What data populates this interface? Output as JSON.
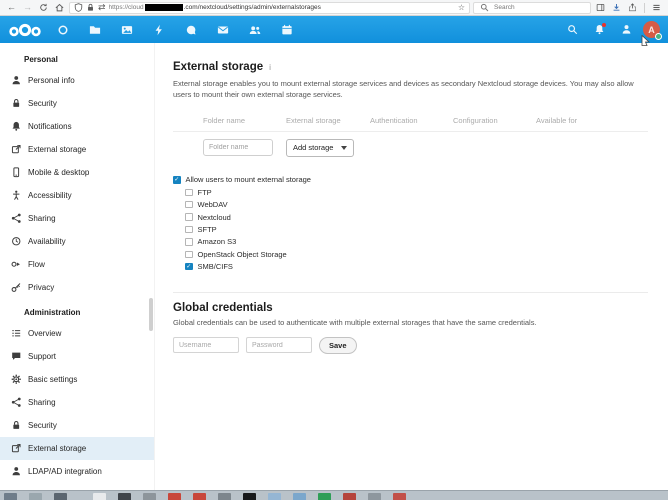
{
  "browser": {
    "icons": [
      "back-icon",
      "forward-icon",
      "reload-icon",
      "home-icon",
      "shield-icon",
      "lock-icon",
      "permissions-icon",
      "bookmark-star-icon",
      "search-icon",
      "sidebar-icon",
      "download-icon",
      "share-icon",
      "menu-icon"
    ],
    "url_prefix": "https://cloud",
    "url_redacted": true,
    "url_suffix": ".com/nextcloud/settings/admin/externalstorages",
    "search_placeholder": "Search"
  },
  "app_header": {
    "logo": "nextcloud-logo",
    "app_icons": [
      "dashboard-icon",
      "files-icon",
      "photos-icon",
      "activity-icon",
      "talk-icon",
      "mail-icon",
      "contacts-icon",
      "calendar-icon"
    ],
    "right_icons": [
      "search-icon",
      "notifications-icon",
      "contacts-menu-icon"
    ],
    "avatar_letter": "A",
    "has_unread_notification": true
  },
  "sidebar": {
    "sections": [
      {
        "title": "Personal",
        "items": [
          {
            "icon": "user-icon",
            "label": "Personal info"
          },
          {
            "icon": "lock-icon",
            "label": "Security"
          },
          {
            "icon": "bell-icon",
            "label": "Notifications"
          },
          {
            "icon": "external-link-icon",
            "label": "External storage"
          },
          {
            "icon": "mobile-icon",
            "label": "Mobile & desktop"
          },
          {
            "icon": "accessibility-icon",
            "label": "Accessibility"
          },
          {
            "icon": "share-icon",
            "label": "Sharing"
          },
          {
            "icon": "clock-icon",
            "label": "Availability"
          },
          {
            "icon": "flow-icon",
            "label": "Flow"
          },
          {
            "icon": "key-icon",
            "label": "Privacy"
          }
        ]
      },
      {
        "title": "Administration",
        "items": [
          {
            "icon": "overview-icon",
            "label": "Overview",
            "active": false
          },
          {
            "icon": "support-icon",
            "label": "Support",
            "active": false
          },
          {
            "icon": "settings-icon",
            "label": "Basic settings",
            "active": false
          },
          {
            "icon": "share-icon",
            "label": "Sharing",
            "active": false
          },
          {
            "icon": "lock-icon",
            "label": "Security",
            "active": false
          },
          {
            "icon": "external-link-icon",
            "label": "External storage",
            "active": true
          },
          {
            "icon": "user-icon",
            "label": "LDAP/AD integration",
            "active": false
          }
        ]
      }
    ]
  },
  "main": {
    "title": "External storage",
    "info_icon": "i",
    "description": "External storage enables you to mount external storage services and devices as secondary Nextcloud storage devices. You may also allow users to mount their own external storage services.",
    "table": {
      "headers": [
        "Folder name",
        "External storage",
        "Authentication",
        "Configuration",
        "Available for"
      ]
    },
    "folder_input_placeholder": "Folder name",
    "add_storage_label": "Add storage",
    "allow_checkbox": {
      "label": "Allow users to mount external storage",
      "checked": true
    },
    "backends": [
      {
        "label": "FTP",
        "checked": false
      },
      {
        "label": "WebDAV",
        "checked": false
      },
      {
        "label": "Nextcloud",
        "checked": false
      },
      {
        "label": "SFTP",
        "checked": false
      },
      {
        "label": "Amazon S3",
        "checked": false
      },
      {
        "label": "OpenStack Object Storage",
        "checked": false
      },
      {
        "label": "SMB/CIFS",
        "checked": true
      }
    ],
    "global_credentials": {
      "title": "Global credentials",
      "description": "Global credentials can be used to authenticate with multiple external storages that have the same credentials.",
      "username_placeholder": "Username",
      "password_placeholder": "Password",
      "save_label": "Save"
    }
  },
  "colors": {
    "accent": "#0082c9",
    "header_top": "#27a3e7",
    "header_bottom": "#1190dc",
    "active_item_bg": "#e2eef7",
    "avatar_bg": "#d65b46",
    "status_online": "#49b382",
    "notification_red": "#e9322d",
    "checkbox_checked": "#1583c0"
  }
}
